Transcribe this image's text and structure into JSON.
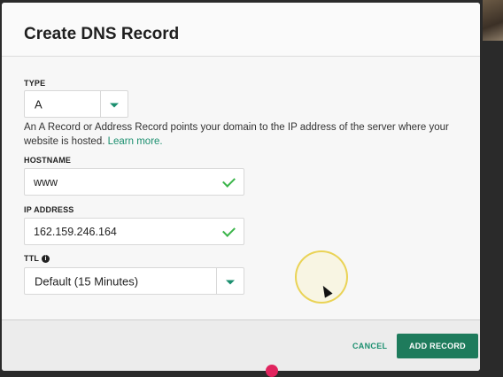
{
  "dialog": {
    "title": "Create DNS Record"
  },
  "type_field": {
    "label": "TYPE",
    "selected": "A"
  },
  "help": {
    "text": "An A Record or Address Record points your domain to the IP address of the server where your website is hosted. ",
    "link": "Learn more."
  },
  "hostname": {
    "label": "HOSTNAME",
    "value": "www"
  },
  "ip_address": {
    "label": "IP ADDRESS",
    "value": "162.159.246.164"
  },
  "ttl": {
    "label": "TTL",
    "info_glyph": "i",
    "selected": "Default (15 Minutes)"
  },
  "footer": {
    "cancel_label": "CANCEL",
    "add_label": "ADD RECORD"
  },
  "colors": {
    "accent": "#1b8f6f",
    "primary_button": "#1e7b5c",
    "valid_check": "#3bb54a"
  }
}
